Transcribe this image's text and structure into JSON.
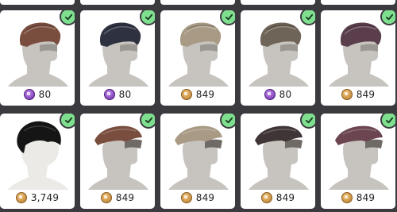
{
  "grid": {
    "rows": [
      [
        {
          "price": "80",
          "currency": "premium-gem",
          "owned": true,
          "hair_color": "#7a4e3f",
          "style": "quiff"
        },
        {
          "price": "80",
          "currency": "premium-gem",
          "owned": true,
          "hair_color": "#2e3140",
          "style": "quiff"
        },
        {
          "price": "849",
          "currency": "gold-coin",
          "owned": true,
          "hair_color": "#a89a85",
          "style": "quiff"
        },
        {
          "price": "80",
          "currency": "premium-gem",
          "owned": true,
          "hair_color": "#6f6458",
          "style": "quiff"
        },
        {
          "price": "849",
          "currency": "gold-coin",
          "owned": true,
          "hair_color": "#5a3e4c",
          "style": "quiff"
        }
      ],
      [
        {
          "price": "3,749",
          "currency": "gold-coin",
          "owned": true,
          "hair_color": "#151515",
          "style": "bowl"
        },
        {
          "price": "849",
          "currency": "gold-coin",
          "owned": true,
          "hair_color": "#7a4e3f",
          "style": "swept"
        },
        {
          "price": "849",
          "currency": "gold-coin",
          "owned": true,
          "hair_color": "#a89a85",
          "style": "swept"
        },
        {
          "price": "849",
          "currency": "gold-coin",
          "owned": true,
          "hair_color": "#3f3436",
          "style": "swept"
        },
        {
          "price": "849",
          "currency": "gold-coin",
          "owned": true,
          "hair_color": "#6b4550",
          "style": "swept"
        }
      ]
    ]
  },
  "colors": {
    "background": "#3b3a3f",
    "card": "#ffffff",
    "owned_check": "#7ee08f",
    "mannequin": "#c7c4c0"
  }
}
